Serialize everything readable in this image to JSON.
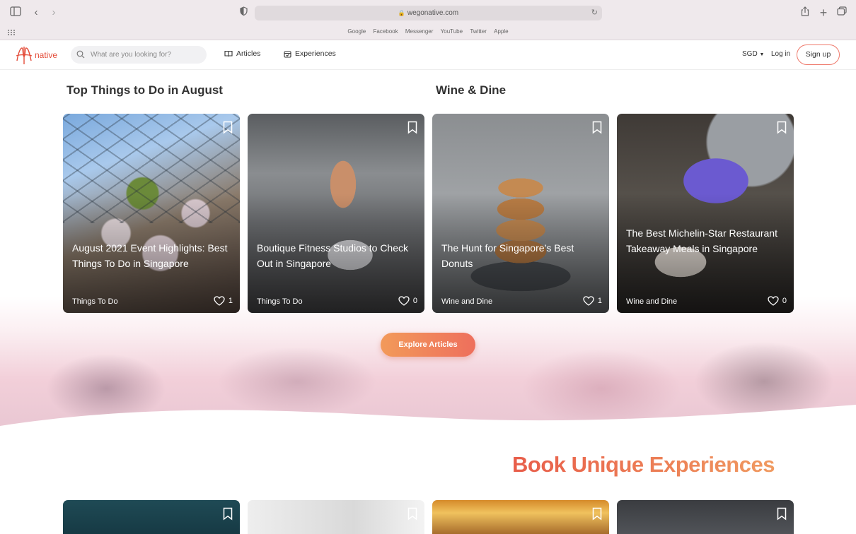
{
  "browser": {
    "url": "wegonative.com",
    "favorites": [
      "Google",
      "Facebook",
      "Messenger",
      "YouTube",
      "Twitter",
      "Apple"
    ]
  },
  "nav": {
    "logo_text": "native",
    "search_placeholder": "What are you looking for?",
    "articles_label": "Articles",
    "experiences_label": "Experiences",
    "currency": "SGD",
    "login_label": "Log in",
    "signup_label": "Sign up"
  },
  "sections": {
    "top_things": "Top Things to Do in August",
    "wine_dine": "Wine & Dine"
  },
  "cards": [
    {
      "title": "August 2021 Event Highlights: Best Things To Do in Singapore",
      "category": "Things To Do",
      "likes": "1"
    },
    {
      "title": "Boutique Fitness Studios to Check Out in Singapore",
      "category": "Things To Do",
      "likes": "0"
    },
    {
      "title": "The Hunt for Singapore’s Best Donuts",
      "category": "Wine and Dine",
      "likes": "1"
    },
    {
      "title": "The Best Michelin-Star Restaurant Takeaway Meals in Singapore",
      "category": "Wine and Dine",
      "likes": "0"
    }
  ],
  "explore_label": "Explore Articles",
  "book_title": "Book Unique Experiences",
  "colors": {
    "brand": "#e44d3a",
    "accent_gradient_start": "#f29a5a",
    "accent_gradient_end": "#ee6f5c"
  }
}
